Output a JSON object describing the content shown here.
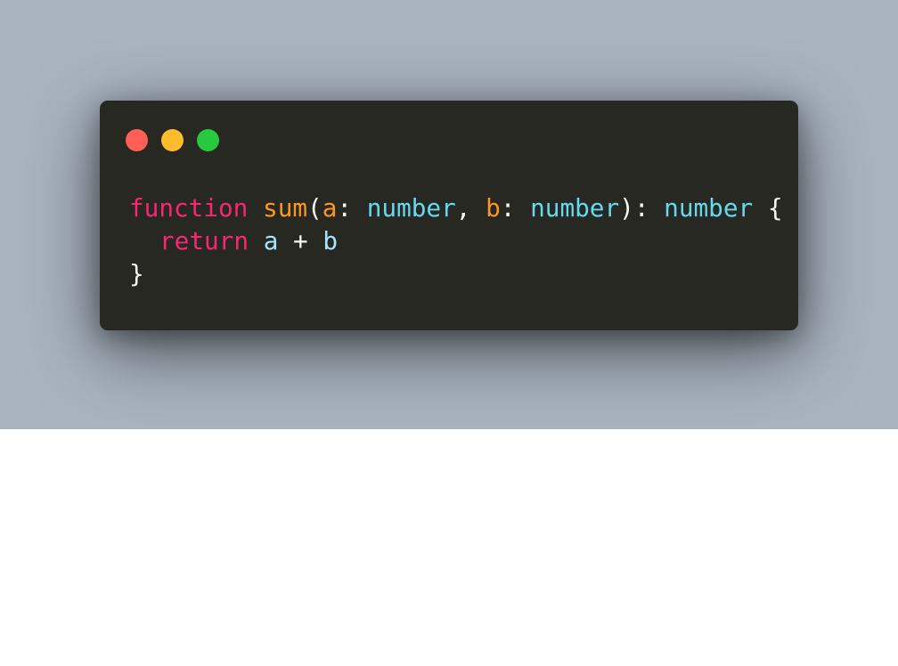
{
  "window": {
    "controls": [
      {
        "name": "close",
        "color": "#ff5f56"
      },
      {
        "name": "minimize",
        "color": "#ffbd2e"
      },
      {
        "name": "zoom",
        "color": "#27c93f"
      }
    ],
    "background": "#272822"
  },
  "colors": {
    "keyword": "#f92672",
    "function": "#fd971f",
    "param": "#fd971f",
    "type": "#66d9ef",
    "identifier": "#a6e3ff",
    "text": "#f8f8f2",
    "backdrop": "#a9b4c0"
  },
  "code": {
    "line1": {
      "t1": "function",
      "t2": " ",
      "t3": "sum",
      "t4": "(",
      "t5": "a",
      "t6": ": ",
      "t7": "number",
      "t8": ", ",
      "t9": "b",
      "t10": ": ",
      "t11": "number",
      "t12": "): ",
      "t13": "number",
      "t14": " {"
    },
    "line2": {
      "t1": "return",
      "t2": " ",
      "t3": "a",
      "t4": " + ",
      "t5": "b"
    },
    "line3": {
      "t1": "}"
    }
  }
}
